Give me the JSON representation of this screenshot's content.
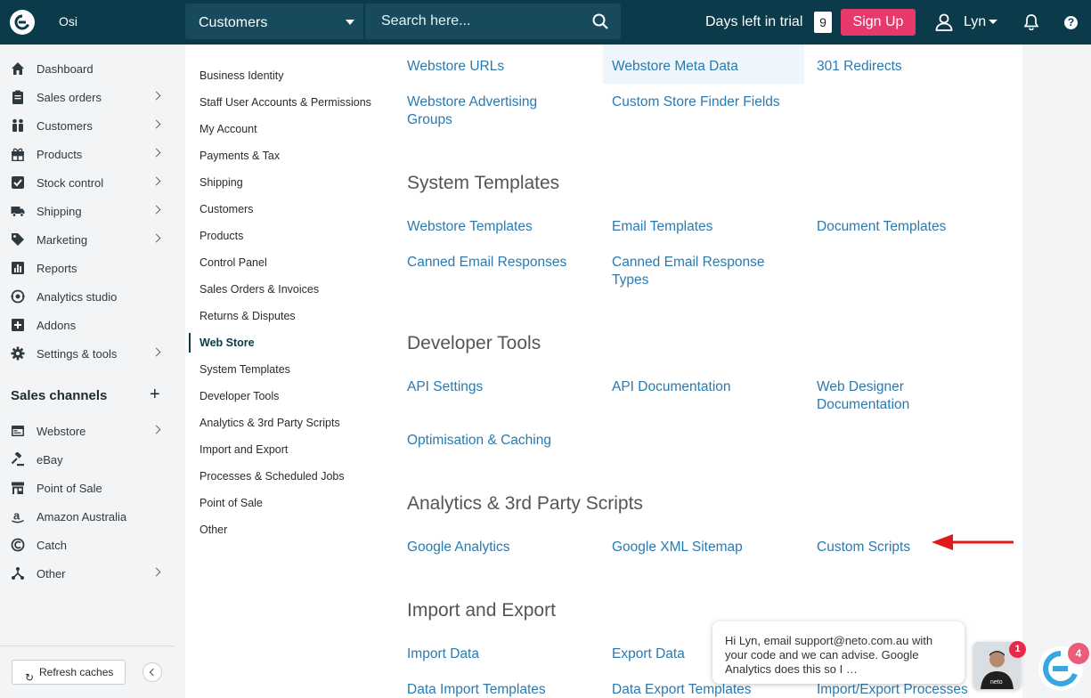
{
  "header": {
    "brand": "Osi",
    "module_select": "Customers",
    "search_placeholder": "Search here...",
    "trial_label": "Days left in trial",
    "trial_days": "9",
    "signup_label": "Sign Up",
    "user_name": "Lyn",
    "help": "?"
  },
  "sidebar": {
    "items": [
      {
        "label": "Dashboard",
        "icon": "home-icon"
      },
      {
        "label": "Sales orders",
        "icon": "clipboard-icon"
      },
      {
        "label": "Customers",
        "icon": "people-icon"
      },
      {
        "label": "Products",
        "icon": "gift-icon"
      },
      {
        "label": "Stock control",
        "icon": "checkbox-icon"
      },
      {
        "label": "Shipping",
        "icon": "truck-icon"
      },
      {
        "label": "Marketing",
        "icon": "tag-icon"
      },
      {
        "label": "Reports",
        "icon": "bar-chart-icon"
      },
      {
        "label": "Analytics studio",
        "icon": "analytics-icon"
      },
      {
        "label": "Addons",
        "icon": "plus-square-icon"
      },
      {
        "label": "Settings & tools",
        "icon": "gear-icon"
      }
    ],
    "sales_channels_title": "Sales channels",
    "channels": [
      {
        "label": "Webstore",
        "icon": "webstore-icon"
      },
      {
        "label": "eBay",
        "icon": "gavel-icon"
      },
      {
        "label": "Point of Sale",
        "icon": "store-icon"
      },
      {
        "label": "Amazon Australia",
        "icon": "amazon-icon"
      },
      {
        "label": "Catch",
        "icon": "catch-icon"
      },
      {
        "label": "Other",
        "icon": "network-icon"
      }
    ],
    "refresh_label": "Refresh caches"
  },
  "subnav": {
    "items": [
      "Business Identity",
      "Staff User Accounts & Permissions",
      "My Account",
      "Payments & Tax",
      "Shipping",
      "Customers",
      "Products",
      "Control Panel",
      "Sales Orders & Invoices",
      "Returns & Disputes",
      "Web Store",
      "System Templates",
      "Developer Tools",
      "Analytics & 3rd Party Scripts",
      "Import and Export",
      "Processes & Scheduled Jobs",
      "Point of Sale",
      "Other"
    ],
    "active": "Web Store"
  },
  "webstore": {
    "links": [
      "Webstore URLs",
      "Webstore Meta Data",
      "301 Redirects",
      "Webstore Advertising Groups",
      "Custom Store Finder Fields"
    ]
  },
  "system_templates": {
    "title": "System Templates",
    "links": [
      "Webstore Templates",
      "Email Templates",
      "Document Templates",
      "Canned Email Responses",
      "Canned Email Response Types"
    ]
  },
  "developer_tools": {
    "title": "Developer Tools",
    "links": [
      "API Settings",
      "API Documentation",
      "Web Designer Documentation",
      "Optimisation & Caching"
    ]
  },
  "analytics": {
    "title": "Analytics & 3rd Party Scripts",
    "links": [
      "Google Analytics",
      "Google XML Sitemap",
      "Custom Scripts"
    ]
  },
  "import_export": {
    "title": "Import and Export",
    "links": [
      "Import Data",
      "Export Data",
      "Data Import Templates",
      "Data Export Templates",
      "Import/Export Processes"
    ]
  },
  "chat": {
    "message": "Hi Lyn, email support@neto.com.au with your code and we can advise. Google Analytics does this so I …",
    "badge_count": "1",
    "launcher_count": "4"
  },
  "colors": {
    "topbar": "#0b3a4a",
    "accent_pink": "#e8396c",
    "link_blue": "#2a7ab0",
    "annotation_red": "#e01818"
  }
}
